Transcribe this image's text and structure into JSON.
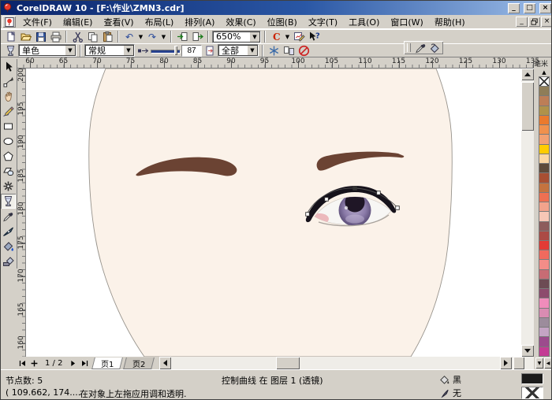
{
  "window": {
    "title": "CorelDRAW 10 - [F:\\作业\\ZMN3.cdr]"
  },
  "menu": {
    "items": [
      "文件(F)",
      "编辑(E)",
      "查看(V)",
      "布局(L)",
      "排列(A)",
      "效果(C)",
      "位图(B)",
      "文字(T)",
      "工具(O)",
      "窗口(W)",
      "帮助(H)"
    ]
  },
  "toolbar": {
    "buttons": [
      "new",
      "open",
      "save",
      "print",
      "cut",
      "copy",
      "paste",
      "undo",
      "redo",
      "import",
      "export"
    ],
    "zoom_value": "650%",
    "right_buttons": [
      "app-launcher",
      "graph-paper",
      "whats-this"
    ]
  },
  "property_bar": {
    "tool_icon": "transparency",
    "transparency_type": "单色",
    "operation": "常规",
    "transparency_value": "87",
    "target": "全部",
    "buttons": [
      "freeze",
      "copy-transparency",
      "clear-transparency"
    ],
    "floating_buttons": [
      "eyedropper",
      "paintbucket"
    ]
  },
  "toolbox": {
    "tools": [
      "pick",
      "shape",
      "pan",
      "freehand",
      "rectangle",
      "ellipse",
      "polygon",
      "basic-shapes",
      "perfect-shapes",
      "transparency",
      "eyedropper",
      "outline-pen",
      "fill",
      "interactive-fill"
    ],
    "active_tool": "transparency"
  },
  "rulers": {
    "h_numbers": [
      60,
      65,
      70,
      75,
      80,
      85,
      90,
      95,
      100,
      105,
      110,
      115,
      120,
      125,
      130,
      135
    ],
    "v_numbers": [
      200,
      195,
      190,
      185,
      180,
      175,
      170,
      165,
      160
    ],
    "unit": "毫米"
  },
  "palette": {
    "colors": [
      "#8f7d58",
      "#bd7e57",
      "#b0924a",
      "#ea7a2e",
      "#f0914d",
      "#f2a172",
      "#ffcc00",
      "#fcd7a4",
      "#5f4b3a",
      "#a84f32",
      "#c4733f",
      "#ee7052",
      "#f2a38c",
      "#f7c7b6",
      "#8d5c5c",
      "#ab4b45",
      "#e23b35",
      "#f06a5e",
      "#f48d88",
      "#c76c74",
      "#6d4b54",
      "#8d4b6d",
      "#f08cbb",
      "#d98cb2",
      "#9c8c9c",
      "#c4a4c4",
      "#9c4b8d",
      "#c43b94"
    ]
  },
  "page_nav": {
    "position": "1 / 2",
    "tabs": [
      "页1",
      "页2"
    ],
    "active_tab": "页1"
  },
  "status": {
    "nodes": "节点数: 5",
    "object_info": "控制曲线 在 图层 1  (透镜)",
    "coords": "( 109.662, 174....",
    "hint": "在对象上左拖应用调和透明.",
    "fill_label": "黑",
    "outline_label": "无",
    "fill_swatch": "#1b1b1b"
  },
  "canvas": {
    "face_fill": "#fbf2e9",
    "face_stroke": "#97938c",
    "eyebrow_color": "#6b4333",
    "lid_color": "#16121b",
    "iris_outer": "#4a3d66",
    "iris_mid": "#8a7aa8",
    "iris_inner": "#b6aacb",
    "pupil_color": "#1f1626",
    "sclera_color": "#f7f6f4",
    "inner_corner_color": "#ecb9bd",
    "selection_nodes": 5
  }
}
